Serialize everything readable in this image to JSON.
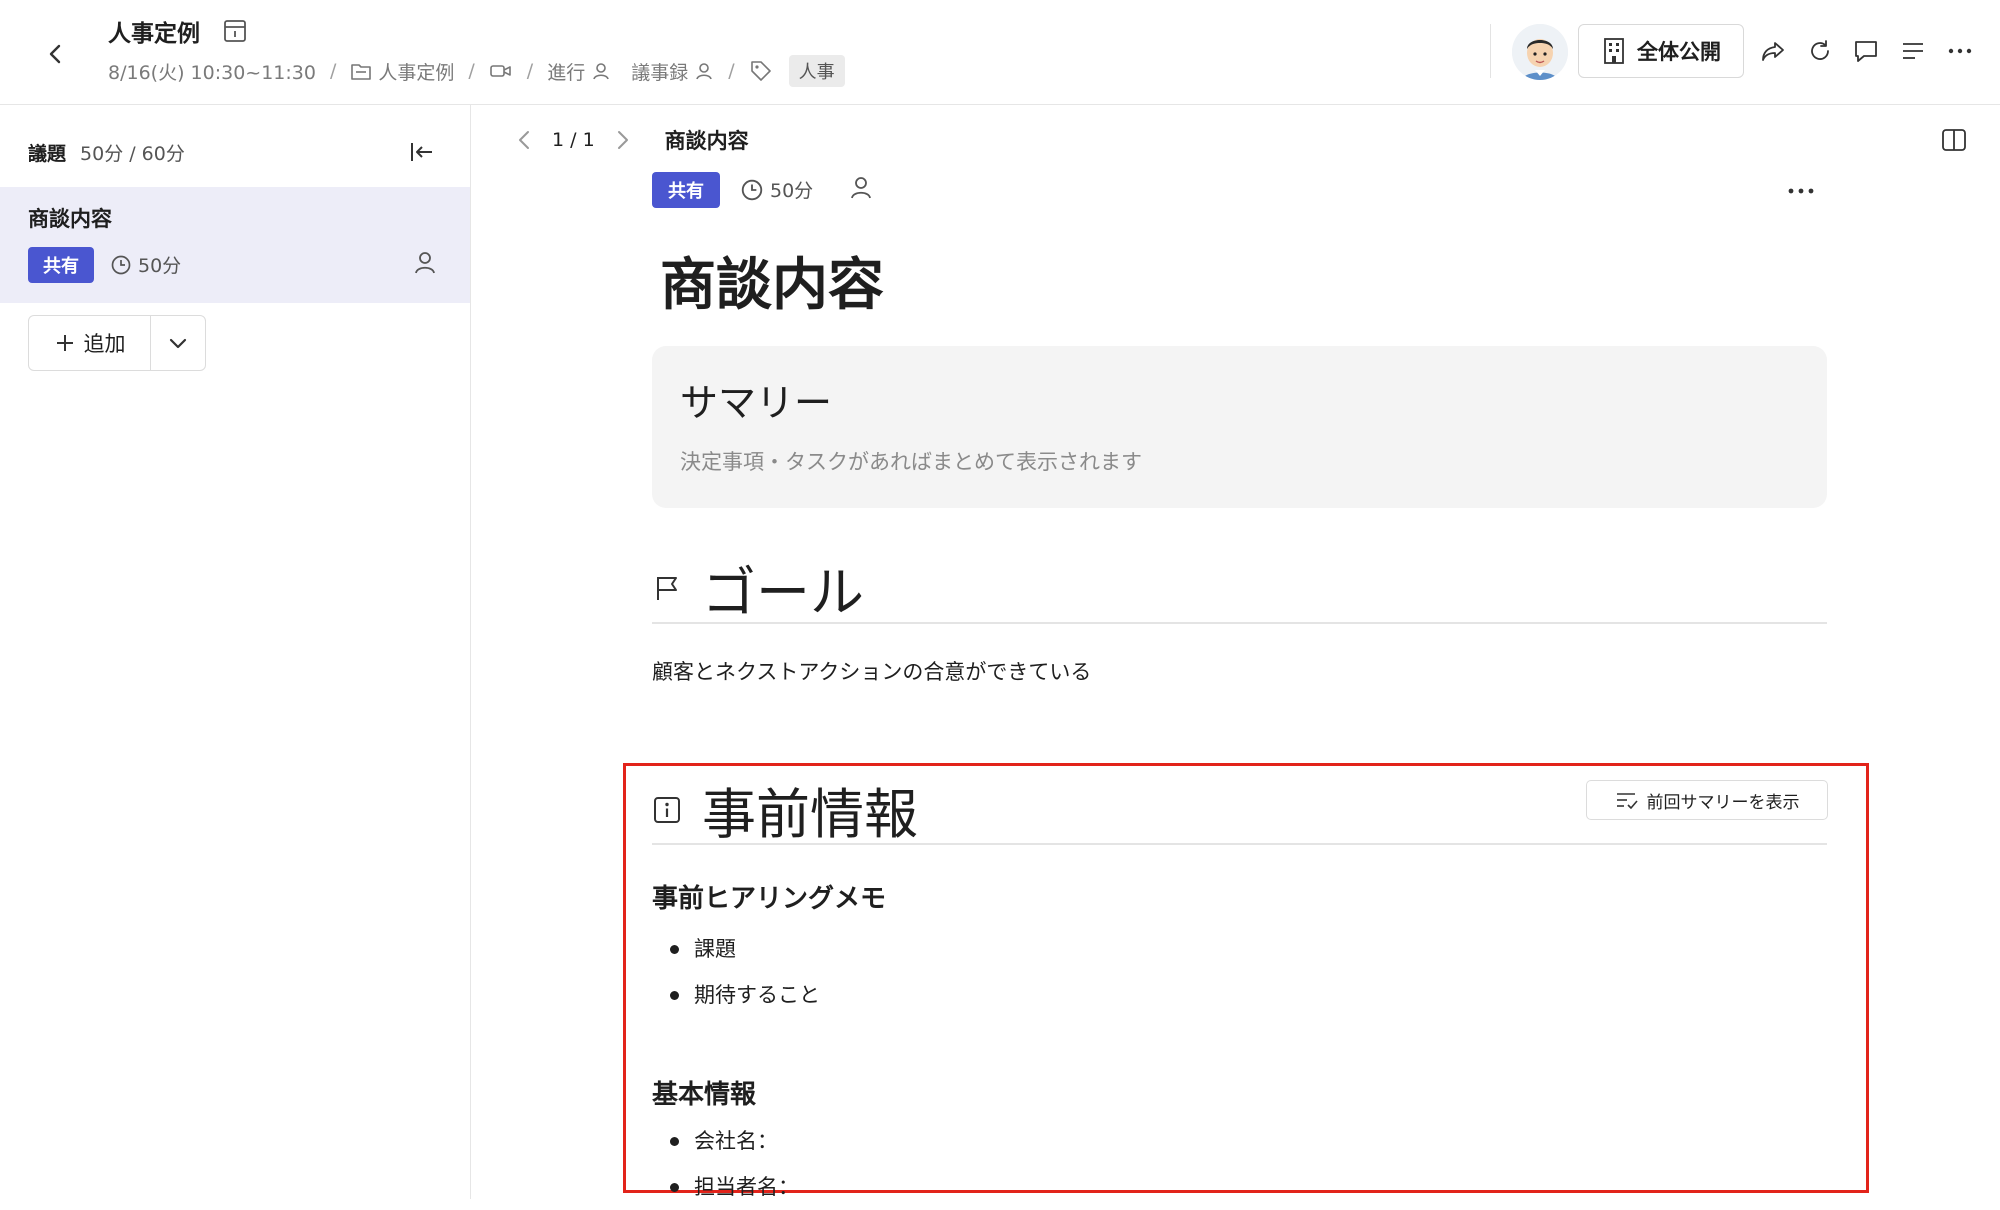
{
  "header": {
    "title": "人事定例",
    "datetime": "8/16(火) 10:30~11:30",
    "folder": "人事定例",
    "facilitator_label": "進行",
    "minutes_label": "議事録",
    "tag": "人事",
    "visibility": "全体公開"
  },
  "sidebar": {
    "heading": "議題",
    "time_summary": "50分 / 60分",
    "agenda_items": [
      {
        "title": "商談内容",
        "badge": "共有",
        "duration": "50分"
      }
    ],
    "add_label": "追加"
  },
  "main": {
    "pager": "1 / 1",
    "page_title": "商談内容",
    "badge": "共有",
    "duration": "50分",
    "heading": "商談内容",
    "summary": {
      "title": "サマリー",
      "description": "決定事項・タスクがあればまとめて表示されます"
    },
    "goal": {
      "title": "ゴール",
      "text": "顧客とネクストアクションの合意ができている"
    },
    "pre_info": {
      "title": "事前情報",
      "prev_summary_label": "前回サマリーを表示",
      "hearing_title": "事前ヒアリングメモ",
      "hearing_items": [
        "課題",
        "期待すること"
      ],
      "basic_title": "基本情報",
      "basic_items": [
        "会社名：",
        "担当者名："
      ]
    }
  },
  "colors": {
    "accent": "#4a56d0",
    "highlight_border": "#e2231a",
    "selected_row": "#ededf8"
  }
}
